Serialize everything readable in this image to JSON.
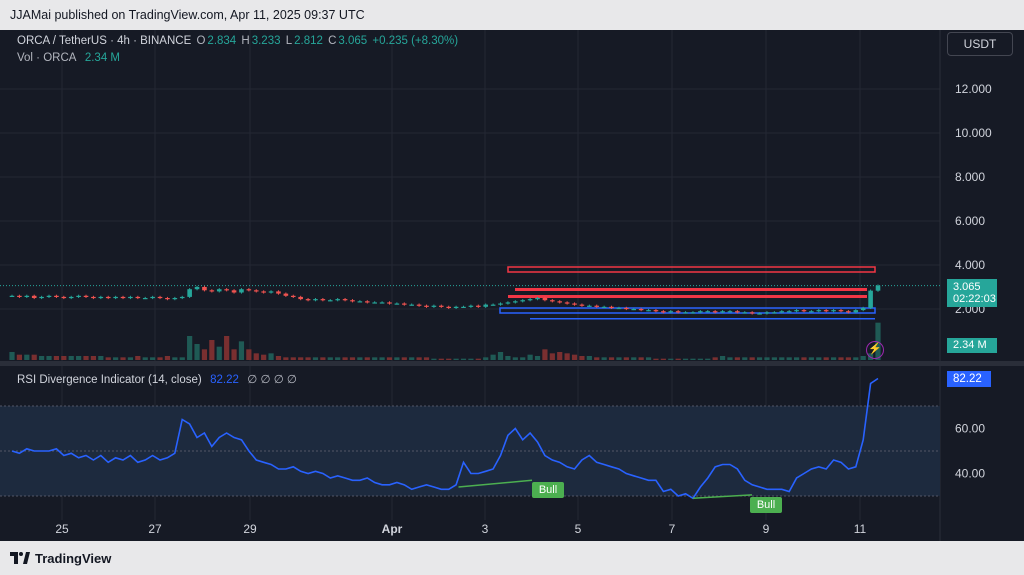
{
  "header": {
    "published": "JJAMai published on TradingView.com, Apr 11, 2025 09:37 UTC"
  },
  "legend": {
    "symbol": "ORCA / TetherUS · 4h · BINANCE",
    "o_label": "O",
    "o": "2.834",
    "h_label": "H",
    "h": "3.233",
    "l_label": "L",
    "l": "2.812",
    "c_label": "C",
    "c": "3.065",
    "change": "+0.235 (+8.30%)",
    "vol_label": "Vol · ORCA",
    "vol": "2.34 M"
  },
  "currency_button": "USDT",
  "price_axis": [
    "12.000",
    "10.000",
    "8.000",
    "6.000",
    "4.000",
    "2.000"
  ],
  "last_price": "3.065",
  "countdown": "02:22:03",
  "volume_badge": "2.34 M",
  "rsi": {
    "title": "RSI Divergence Indicator (14, close)",
    "value": "82.22",
    "null_marks": "∅ ∅ ∅ ∅",
    "axis": [
      "60.00",
      "40.00"
    ],
    "badge": "82.22",
    "bull_label_1": "Bull",
    "bull_label_2": "Bull"
  },
  "time_axis": [
    "25",
    "27",
    "29",
    "Apr",
    "3",
    "5",
    "7",
    "9",
    "11"
  ],
  "footer": {
    "brand": "TradingView"
  },
  "colors": {
    "up": "#26a69a",
    "down": "#ef5350",
    "rsi_line": "#2962ff",
    "bull": "#4caf50",
    "red_zone": "#f23645",
    "blue_zone": "#2962ff"
  },
  "chart_data": [
    {
      "type": "line",
      "name": "ORCA / TetherUS 4h price (approx close)",
      "x_labels": [
        "25",
        "27",
        "29",
        "Apr",
        "3",
        "5",
        "7",
        "9",
        "11"
      ],
      "ylim": [
        0,
        14
      ],
      "values": [
        2.6,
        2.55,
        2.6,
        2.5,
        2.55,
        2.6,
        2.55,
        2.5,
        2.55,
        2.6,
        2.55,
        2.5,
        2.55,
        2.5,
        2.55,
        2.5,
        2.55,
        2.5,
        2.5,
        2.55,
        2.5,
        2.45,
        2.5,
        2.55,
        2.9,
        3.0,
        2.85,
        2.8,
        2.9,
        2.85,
        2.75,
        2.9,
        2.85,
        2.8,
        2.75,
        2.8,
        2.7,
        2.6,
        2.55,
        2.45,
        2.4,
        2.45,
        2.4,
        2.4,
        2.45,
        2.4,
        2.35,
        2.35,
        2.3,
        2.3,
        2.3,
        2.25,
        2.25,
        2.2,
        2.2,
        2.15,
        2.1,
        2.15,
        2.1,
        2.05,
        2.1,
        2.1,
        2.15,
        2.1,
        2.2,
        2.2,
        2.25,
        2.3,
        2.35,
        2.4,
        2.45,
        2.5,
        2.4,
        2.35,
        2.3,
        2.25,
        2.2,
        2.15,
        2.15,
        2.1,
        2.1,
        2.05,
        2.05,
        2.0,
        2.0,
        1.95,
        1.95,
        1.9,
        1.85,
        1.9,
        1.85,
        1.85,
        1.85,
        1.9,
        1.9,
        1.85,
        1.9,
        1.9,
        1.85,
        1.85,
        1.8,
        1.8,
        1.85,
        1.85,
        1.9,
        1.9,
        1.95,
        1.9,
        1.9,
        1.95,
        1.9,
        1.95,
        1.9,
        1.85,
        1.95,
        2.05,
        2.834,
        3.065
      ]
    },
    {
      "type": "bar",
      "name": "Volume",
      "values": [
        6,
        4,
        4,
        4,
        3,
        3,
        3,
        3,
        3,
        3,
        3,
        3,
        3,
        2,
        2,
        2,
        2,
        3,
        2,
        2,
        2,
        3,
        2,
        2,
        18,
        12,
        8,
        15,
        10,
        18,
        8,
        14,
        8,
        5,
        4,
        5,
        3,
        2,
        2,
        2,
        2,
        2,
        2,
        2,
        2,
        2,
        2,
        2,
        2,
        2,
        2,
        2,
        2,
        2,
        2,
        2,
        2,
        1,
        1,
        1,
        1,
        1,
        1,
        1,
        2,
        4,
        6,
        3,
        2,
        2,
        4,
        3,
        8,
        5,
        6,
        5,
        4,
        3,
        3,
        2,
        2,
        2,
        2,
        2,
        2,
        2,
        2,
        1,
        1,
        1,
        1,
        1,
        1,
        1,
        1,
        2,
        3,
        2,
        2,
        2,
        2,
        2,
        2,
        2,
        2,
        2,
        2,
        2,
        2,
        2,
        2,
        2,
        2,
        2,
        2,
        3,
        5,
        28
      ]
    },
    {
      "type": "line",
      "name": "RSI (14, close)",
      "ylim": [
        20,
        90
      ],
      "values": [
        50,
        49,
        51,
        50,
        50,
        50,
        51,
        48,
        49,
        47,
        48,
        46,
        48,
        45,
        47,
        46,
        48,
        45,
        46,
        48,
        46,
        47,
        49,
        64,
        62,
        56,
        58,
        52,
        56,
        58,
        56,
        55,
        50,
        46,
        45,
        44,
        42,
        42,
        43,
        41,
        40,
        41,
        40,
        38,
        39,
        38,
        37,
        37,
        38,
        36,
        35,
        35,
        36,
        35,
        33,
        34,
        35,
        34,
        33,
        33,
        35,
        45,
        40,
        40,
        41,
        42,
        48,
        57,
        60,
        55,
        58,
        54,
        48,
        46,
        45,
        43,
        42,
        46,
        48,
        45,
        44,
        43,
        42,
        40,
        39,
        38,
        37,
        37,
        32,
        33,
        30,
        31,
        29,
        34,
        38,
        43,
        44,
        44,
        42,
        37,
        35,
        34,
        33,
        33,
        33,
        32,
        38,
        40,
        42,
        43,
        42,
        46,
        45,
        42,
        43,
        55,
        80,
        82.22
      ]
    },
    {
      "type": "annotation",
      "name": "Bull divergence",
      "labels": [
        "Bull",
        "Bull"
      ]
    }
  ]
}
